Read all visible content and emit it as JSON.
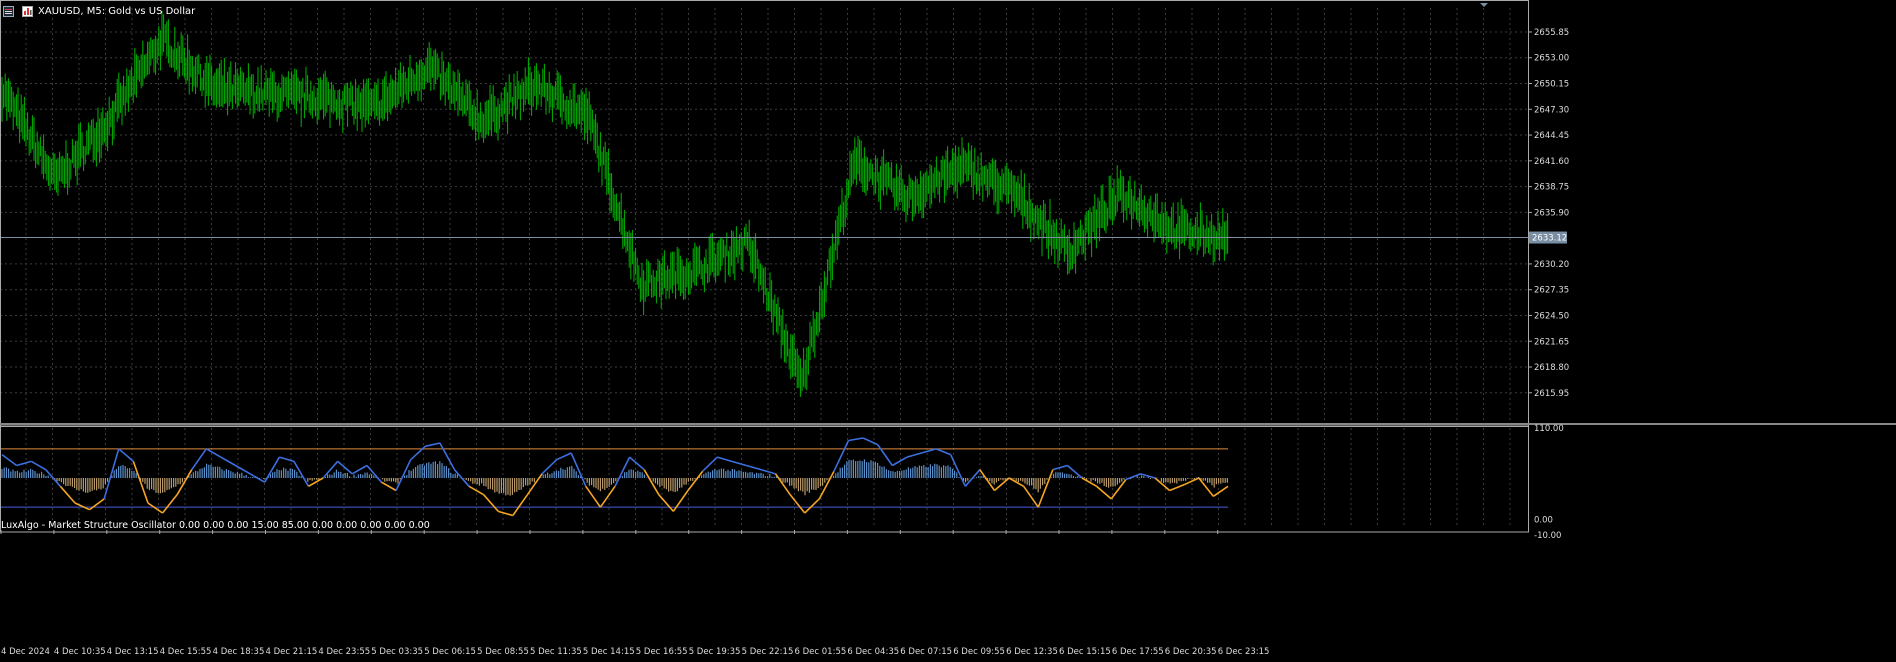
{
  "window": {
    "symbol_title": "XAUUSD, M5:  Gold vs US Dollar",
    "icons": [
      "chart-menu-icon",
      "trade-panel-icon"
    ]
  },
  "price_axis": {
    "labels": [
      "2655.85",
      "2653.00",
      "2650.15",
      "2647.30",
      "2644.45",
      "2641.60",
      "2638.75",
      "2635.90",
      "2630.20",
      "2627.35",
      "2624.50",
      "2621.65",
      "2618.80",
      "2615.95"
    ],
    "current_price": "2633.12"
  },
  "indicator": {
    "title": "LuxAlgo - Market Structure Oscillator 0.00 0.00 0.00 15.00 85.00 0.00 0.00 0.00 0.00 0.00",
    "scale_labels": [
      "110.00",
      "0.00",
      "-10.00"
    ],
    "upper_level": 85,
    "lower_level": 15
  },
  "time_axis": {
    "labels": [
      "4 Dec 2024",
      "4 Dec 10:35",
      "4 Dec 13:15",
      "4 Dec 15:55",
      "4 Dec 18:35",
      "4 Dec 21:15",
      "4 Dec 23:55",
      "5 Dec 03:35",
      "5 Dec 06:15",
      "5 Dec 08:55",
      "5 Dec 11:35",
      "5 Dec 14:15",
      "5 Dec 16:55",
      "5 Dec 19:35",
      "5 Dec 22:15",
      "6 Dec 01:55",
      "6 Dec 04:35",
      "6 Dec 07:15",
      "6 Dec 09:55",
      "6 Dec 12:35",
      "6 Dec 15:15",
      "6 Dec 17:55",
      "6 Dec 20:35",
      "6 Dec 23:15"
    ]
  },
  "colors": {
    "background": "#000000",
    "grid": "#3c3c3c",
    "candles": "#00b400",
    "price_line": "#7a8ea3",
    "price_tag": "#7a8ea3",
    "osc_main": "#3d6fe0",
    "osc_low": "#f5a623",
    "hist_up": "#5b8fc9",
    "hist_down": "#b89a6a",
    "level_upper": "#e08a3c",
    "level_lower": "#4a5ee0"
  },
  "chart_data": {
    "type": "line",
    "title": "XAUUSD, M5:  Gold vs US Dollar",
    "xlabel": "",
    "ylabel": "",
    "ylim": [
      2612.5,
      2658.5
    ],
    "series": [
      {
        "name": "XAUUSD",
        "x": [
          "4 Dec 2024",
          "4 Dec 10:35",
          "4 Dec 13:15",
          "4 Dec 15:55",
          "4 Dec 18:35",
          "4 Dec 21:15",
          "4 Dec 23:55",
          "5 Dec 03:35",
          "5 Dec 06:15",
          "5 Dec 08:55",
          "5 Dec 11:35",
          "5 Dec 14:15",
          "5 Dec 16:55",
          "5 Dec 19:35",
          "5 Dec 22:15",
          "6 Dec 01:55",
          "6 Dec 04:35",
          "6 Dec 07:15",
          "6 Dec 09:55",
          "6 Dec 12:35",
          "6 Dec 15:15",
          "6 Dec 17:55",
          "6 Dec 20:35",
          "6 Dec 23:15"
        ],
        "values": [
          2649.5,
          2639.5,
          2646.0,
          2655.0,
          2649.5,
          2649.0,
          2648.5,
          2647.5,
          2652.0,
          2646.0,
          2650.0,
          2646.5,
          2628.0,
          2629.5,
          2632.5,
          2617.0,
          2641.5,
          2637.5,
          2641.0,
          2638.0,
          2631.5,
          2638.0,
          2634.0,
          2633.1
        ]
      }
    ],
    "oscillator": {
      "name": "Market Structure Oscillator",
      "ylim": [
        -10,
        110
      ],
      "levels": [
        15,
        85
      ],
      "values": [
        78,
        65,
        70,
        60,
        40,
        20,
        12,
        25,
        85,
        70,
        20,
        8,
        30,
        60,
        85,
        75,
        65,
        55,
        45,
        75,
        70,
        40,
        50,
        70,
        55,
        65,
        45,
        35,
        72,
        88,
        92,
        60,
        40,
        30,
        10,
        5,
        30,
        55,
        72,
        80,
        40,
        15,
        40,
        75,
        60,
        30,
        10,
        35,
        58,
        75,
        70,
        65,
        60,
        55,
        30,
        8,
        25,
        58,
        95,
        98,
        90,
        65,
        75,
        80,
        85,
        78,
        40,
        60,
        35,
        50,
        40,
        15,
        60,
        65,
        50,
        40,
        25,
        48,
        55,
        50,
        35,
        42,
        50,
        28,
        40
      ]
    }
  }
}
